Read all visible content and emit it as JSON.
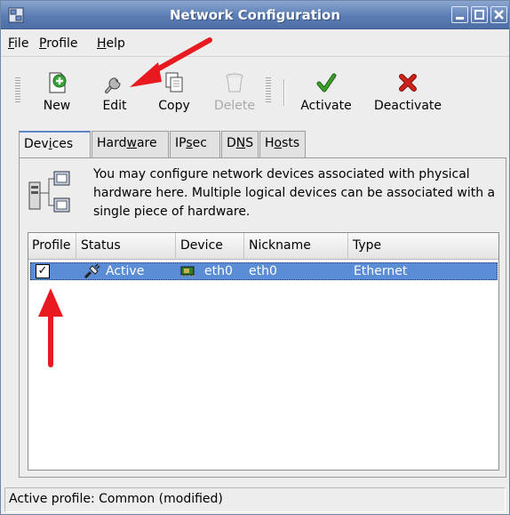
{
  "window": {
    "title": "Network Configuration"
  },
  "menubar": {
    "items": [
      {
        "mnemonic": "F",
        "rest": "ile"
      },
      {
        "mnemonic": "P",
        "rest": "rofile"
      },
      {
        "mnemonic": "H",
        "rest": "elp"
      }
    ]
  },
  "toolbar": {
    "new_label": "New",
    "edit_label": "Edit",
    "copy_label": "Copy",
    "delete_label": "Delete",
    "activate_label": "Activate",
    "deactivate_label": "Deactivate"
  },
  "tabs": [
    {
      "pre": "Dev",
      "mnemonic": "i",
      "post": "ces"
    },
    {
      "pre": "Hard",
      "mnemonic": "w",
      "post": "are"
    },
    {
      "pre": "IP",
      "mnemonic": "s",
      "post": "ec"
    },
    {
      "pre": "D",
      "mnemonic": "N",
      "post": "S"
    },
    {
      "pre": "H",
      "mnemonic": "o",
      "post": "sts"
    }
  ],
  "devices_tab": {
    "info_text": "You may configure network devices associated with physical hardware here.  Multiple logical devices can be associated with a single piece of hardware."
  },
  "table": {
    "columns": [
      "Profile",
      "Status",
      "Device",
      "Nickname",
      "Type"
    ],
    "rows": [
      {
        "profile_checked": true,
        "status": "Active",
        "device": "eth0",
        "nickname": "eth0",
        "type": "Ethernet"
      }
    ]
  },
  "statusbar": {
    "text": "Active profile: Common (modified)"
  },
  "colors": {
    "titlebar": "#5b7db4",
    "selection": "#5b8cd6",
    "annotation_arrow": "#e8191f",
    "activate_icon": "#3aa02a",
    "deactivate_icon": "#d0201a"
  }
}
